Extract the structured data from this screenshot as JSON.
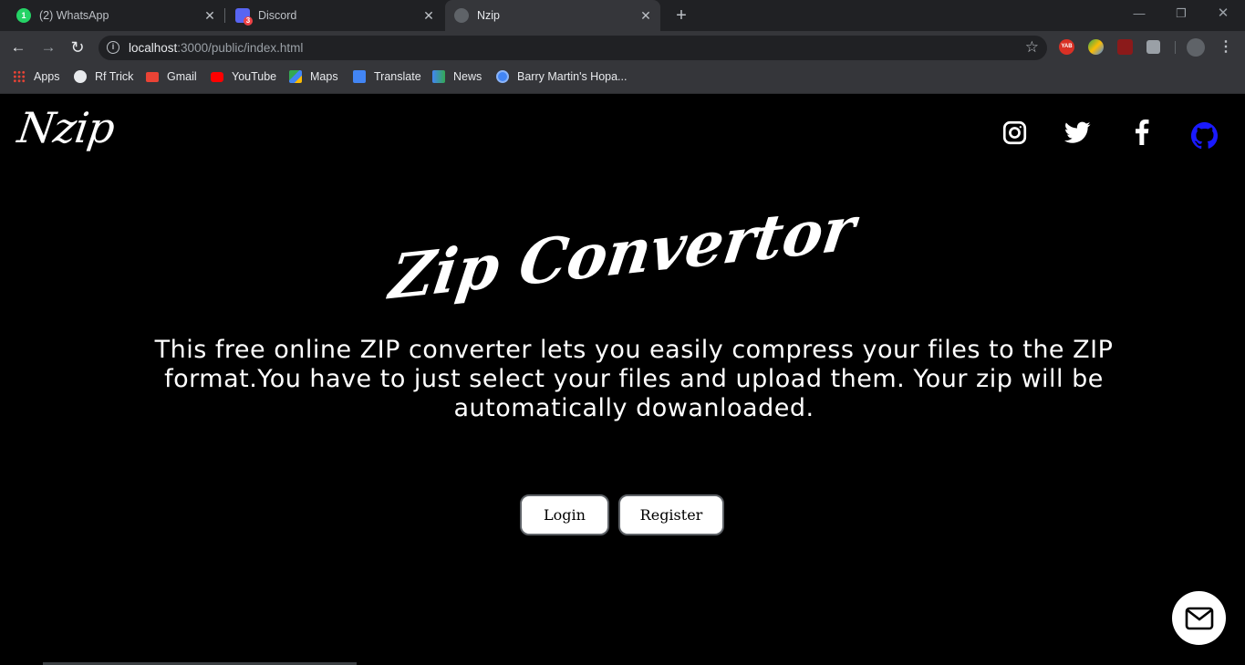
{
  "browser": {
    "tabs": [
      {
        "title": "(2) WhatsApp",
        "badge": "1",
        "icon": "whatsapp-icon",
        "color": "#25d366"
      },
      {
        "title": "Discord",
        "badge": "3",
        "icon": "discord-icon",
        "color": "#5865f2"
      },
      {
        "title": "Nzip",
        "icon": "globe-icon",
        "active": true
      }
    ],
    "url_host": "localhost",
    "url_rest": ":3000/public/index.html",
    "bookmarks": [
      {
        "label": "Apps",
        "icon": "apps-grid-icon"
      },
      {
        "label": "Rf Trick",
        "icon": "globe-icon"
      },
      {
        "label": "Gmail",
        "icon": "gmail-icon"
      },
      {
        "label": "YouTube",
        "icon": "youtube-icon"
      },
      {
        "label": "Maps",
        "icon": "maps-icon"
      },
      {
        "label": "Translate",
        "icon": "translate-icon"
      },
      {
        "label": "News",
        "icon": "news-icon"
      },
      {
        "label": "Barry Martin's Hopa...",
        "icon": "chrome-web-icon"
      }
    ],
    "extensions": [
      {
        "label": "YAB",
        "icon": "yab-extension-icon",
        "color": "#d93025"
      }
    ]
  },
  "page": {
    "brand": "Nzip",
    "headline": "Zip Convertor",
    "description": "This free online ZIP converter lets you easily compress your files to the ZIP format.You have to just select your files and upload them. Your zip will be automatically dowanloaded.",
    "buttons": {
      "login": "Login",
      "register": "Register"
    },
    "social": [
      "instagram-icon",
      "twitter-icon",
      "facebook-icon",
      "github-icon"
    ],
    "colors": {
      "github": "#1a1aff",
      "background": "#000000",
      "text": "#ffffff"
    }
  }
}
